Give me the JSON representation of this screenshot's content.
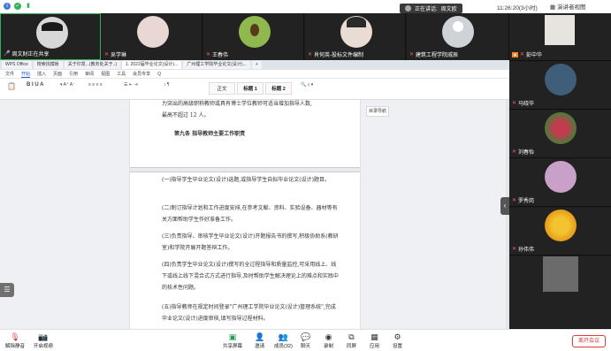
{
  "topbar": {
    "speaking_label": "正在讲话:",
    "speaking_name": "周文欧",
    "clock": "11:26:20(3小时)",
    "view_button": "演讲者视图"
  },
  "participants_top": [
    {
      "name": "周文财正在共享",
      "mic": "on"
    },
    {
      "name": "吴学琳",
      "mic": "off"
    },
    {
      "name": "王春伟",
      "mic": "off"
    },
    {
      "name": "肖何英-投标文件编制",
      "mic": "off"
    },
    {
      "name": "建筑工程学院戚辰",
      "mic": "off"
    }
  ],
  "participants_right": [
    {
      "name": "彭中华",
      "mic": "off"
    },
    {
      "name": "马晓华",
      "mic": "off"
    },
    {
      "name": "刘春怡",
      "mic": "off"
    },
    {
      "name": "罗秀岗",
      "mic": "off"
    },
    {
      "name": "孙伟伟",
      "mic": "off"
    },
    {
      "name": "",
      "mic": "off"
    }
  ],
  "share": {
    "tabs": [
      "WPS Office",
      "搜索找模板",
      "关于印发...(教务处关于..)",
      "1. 2022届毕业论文(设计)...",
      "广州理工学院毕业论文(设计)...",
      "+"
    ],
    "menu": [
      "文件",
      "开始",
      "插入",
      "页面",
      "引用",
      "审阅",
      "视图",
      "工具",
      "会员专享",
      "Q"
    ],
    "active_menu": "开始",
    "styles": [
      "正文",
      "标题 1",
      "标题 2"
    ],
    "side_button": "目录导航",
    "doc_paragraphs": [
      "力突出的高级职称教师或具有博士学位教师可适当增加指导人数,",
      "最高不超过 12 人。",
      "第九条  指导教师主要工作职责",
      "(一)指导学生毕业论文(设计)选题,或指导学生自拟毕业论文(设计)题目。",
      "(二)制订指导计划和工作进度安排,在参考文献、资料、实验设备、器材等有关方面帮助学生作好准备工作。",
      "(三)负责指导、审核学生毕业论文(设计)开题报告书的撰写,积极协助系(教研室)和学院开展开题答辩工作。",
      "(四)负责学生毕业论文(设计)撰写的全过程指导和质量监控,可采用线上、线下或线上线下混合式方式进行指导,及时帮助学生解决理论上的难点和实践中的技术性问题。",
      "(五)指导教师在规定时间登录\"广州理工学院毕业论文(设计)管理系统\",完成毕业论文(设计)进度审核,填写指导过程材料。"
    ]
  },
  "bottombar": {
    "unmute": "解除静音",
    "start_video": "开启视频",
    "share_screen": "共享屏幕",
    "invite": "邀请",
    "members": "成员(32)",
    "chat": "聊天",
    "record": "录制",
    "breakout": "同屏",
    "apps": "应用",
    "settings": "设置",
    "leave": "离开会议"
  },
  "colors": {
    "accent_red": "#e03a3a",
    "share_green": "#20a050",
    "wps_blue": "#1a5fd1"
  }
}
